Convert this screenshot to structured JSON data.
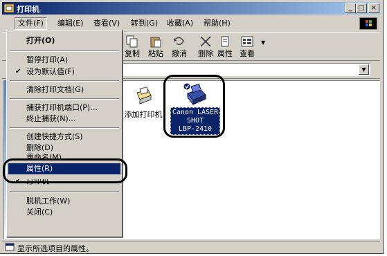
{
  "window": {
    "title": "打印机"
  },
  "title_buttons": {
    "minimize": "_",
    "maximize": "□",
    "close": "×"
  },
  "menubar": {
    "items": [
      "文件(F)",
      "编辑(E)",
      "查看(V)",
      "转到(G)",
      "收藏(A)",
      "帮助(H)"
    ]
  },
  "toolbar": {
    "items": [
      "复制",
      "粘贴",
      "撤消",
      "删除",
      "属性",
      "查看"
    ]
  },
  "address": {
    "dropdown_glyph": "▼"
  },
  "file_menu": {
    "open": "打开(O)",
    "pause": "暂停打印(A)",
    "set_default": "设为默认值(F)",
    "check_glyph": "✔",
    "clear": "清除打印文档(G)",
    "capture_port": "捕获打印机端口(P)...",
    "end_capture": "终止捕获(N)...",
    "create_shortcut": "创建快捷方式(S)",
    "delete": "删除(D)",
    "rename": "重命名(M)",
    "properties": "属性(R)",
    "printers": "打印机",
    "work_offline": "脱机工作(W)",
    "close": "关闭(C)"
  },
  "icons": {
    "add_printer": "添加打印机",
    "printer_line1": "Canon LASER",
    "printer_line2": "SHOT",
    "printer_line3": "LBP-2410"
  },
  "statusbar": {
    "text": "显示所选项目的属性。"
  }
}
